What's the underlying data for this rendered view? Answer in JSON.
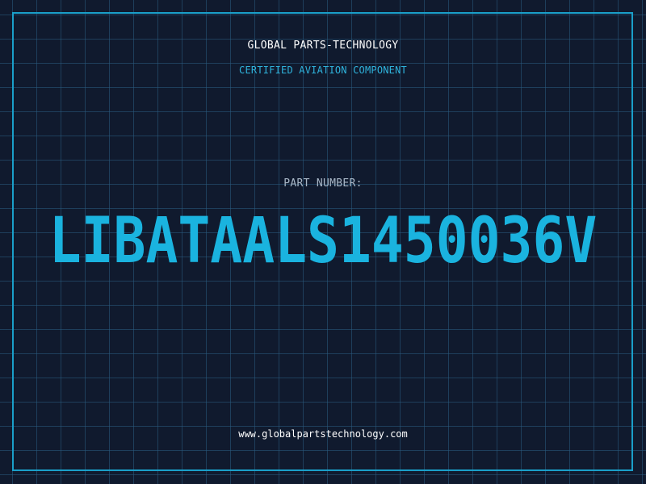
{
  "header": {
    "company": "GLOBAL PARTS-TECHNOLOGY",
    "subtitle": "CERTIFIED AVIATION COMPONENT"
  },
  "part": {
    "label": "PART NUMBER:",
    "number": "LIBATAALS1450036V"
  },
  "footer": {
    "website": "www.globalpartstechnology.com"
  },
  "colors": {
    "background": "#101a2e",
    "grid": "#2a5c80",
    "frame": "#1a9fc9",
    "accent": "#1ab3df",
    "label": "#a9b8c8",
    "text": "#ffffff"
  }
}
